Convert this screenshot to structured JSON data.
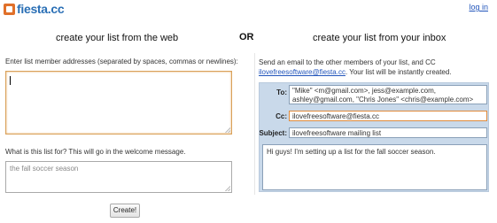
{
  "app": {
    "logo_text": "fiesta.cc",
    "login_label": "log in"
  },
  "left": {
    "title": "create your list from the web",
    "addresses_label": "Enter list member addresses (separated by spaces, commas or newlines):",
    "addresses_value": "",
    "purpose_label": "What is this list for? This will go in the welcome message.",
    "purpose_placeholder": "the fall soccer season",
    "create_button": "Create!"
  },
  "or_label": "OR",
  "right": {
    "title": "create your list from your inbox",
    "instruction_prefix": "Send an email to the other members of your list, and CC",
    "instruction_email": "ilovefreesoftware@fiesta.cc",
    "instruction_suffix": ". Your list will be instantly created.",
    "compose": {
      "to_label": "To:",
      "to_line1": "\"Mike\" <m@gmail.com>, jess@example.com,",
      "to_line2": "ashley@gmail.com, \"Chris Jones\" <chris@example.com>",
      "cc_label": "Cc:",
      "cc_value": "ilovefreesoftware@fiesta.cc",
      "subject_label": "Subject:",
      "subject_value": "ilovefreesoftware mailing list",
      "body_value": "Hi guys! I'm setting up a list for the fall soccer season."
    }
  },
  "colors": {
    "accent_orange": "#e0702a",
    "brand_blue": "#2a6fb5",
    "link_blue": "#2255bb",
    "panel_bg": "#c9d9ea"
  }
}
